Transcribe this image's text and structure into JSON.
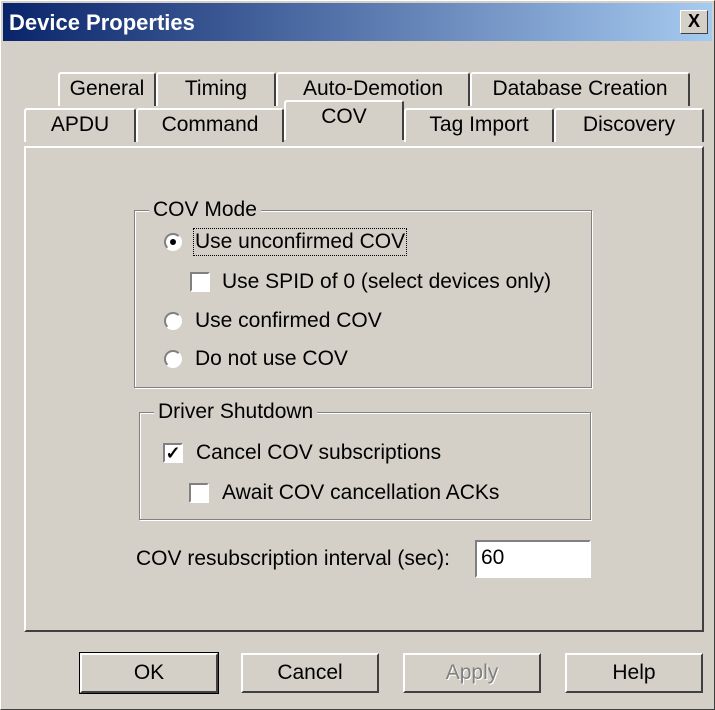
{
  "window": {
    "title": "Device Properties",
    "close_symbol": "X"
  },
  "tabs": {
    "row1": [
      "General",
      "Timing",
      "Auto-Demotion",
      "Database Creation"
    ],
    "row2": [
      "APDU",
      "Command",
      "COV",
      "Tag Import",
      "Discovery"
    ],
    "active": "COV"
  },
  "cov_mode": {
    "label": "COV Mode",
    "use_unconfirmed": {
      "label": "Use unconfirmed COV",
      "selected": true
    },
    "use_spid_zero": {
      "label": "Use SPID of 0 (select devices only)",
      "checked": false
    },
    "use_confirmed": {
      "label": "Use confirmed COV",
      "selected": false
    },
    "do_not_use": {
      "label": "Do not use COV",
      "selected": false
    }
  },
  "driver_shutdown": {
    "label": "Driver Shutdown",
    "cancel_subscriptions": {
      "label": "Cancel COV subscriptions",
      "checked": true
    },
    "await_acks": {
      "label": "Await COV cancellation ACKs",
      "checked": false
    }
  },
  "resubscription": {
    "label": "COV resubscription interval (sec):",
    "value": "60"
  },
  "buttons": {
    "ok": "OK",
    "cancel": "Cancel",
    "apply": "Apply",
    "help": "Help"
  }
}
